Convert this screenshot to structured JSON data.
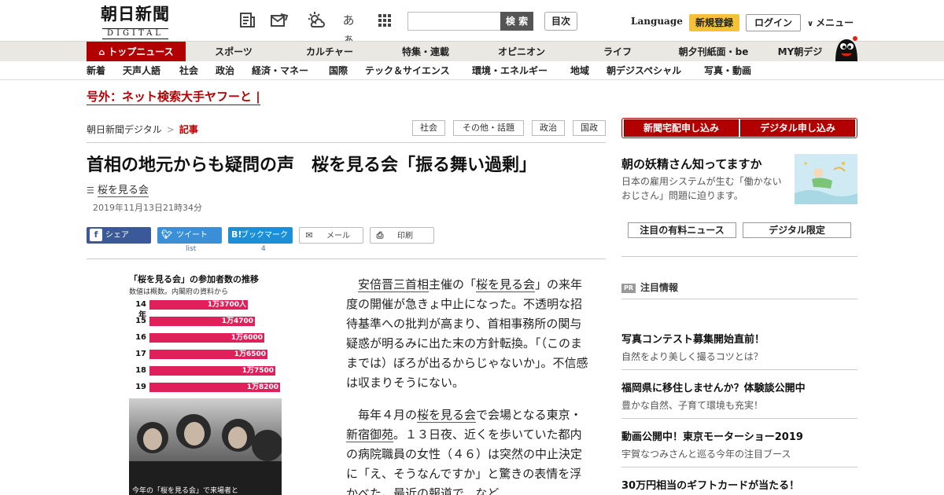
{
  "header": {
    "logo_main": "朝日新聞",
    "logo_sub": "DIGITAL",
    "search_button": "検 索",
    "search_placeholder": "",
    "index_button": "目次",
    "language": "Language",
    "register": "新規登録",
    "login": "ログイン",
    "menu": "メニュー",
    "icon_font_label": "あぁ"
  },
  "nav_primary": [
    {
      "label": "トップニュース",
      "active": true
    },
    {
      "label": "スポーツ"
    },
    {
      "label": "カルチャー"
    },
    {
      "label": "特集・連載"
    },
    {
      "label": "オピニオン"
    },
    {
      "label": "ライフ"
    },
    {
      "label": "朝夕刊紙面・be"
    },
    {
      "label": "MY朝デジ"
    }
  ],
  "nav_secondary": [
    "新着",
    "天声人語",
    "社会",
    "政治",
    "経済・マネー",
    "国際",
    "テック＆サイエンス",
    "環境・エネルギー",
    "地域",
    "朝デジスペシャル",
    "写真・動画"
  ],
  "breaking": "号外：ネット検索大手ヤフーと",
  "breadcrumb": {
    "home": "朝日新聞デジタル",
    "sep": ">",
    "current": "記事"
  },
  "tags": [
    "社会",
    "その他・話題",
    "政治",
    "国政"
  ],
  "article": {
    "headline": "首相の地元からも疑問の声　桜を見る会「振る舞い過剰」",
    "topic": "桜を見る会",
    "date": "2019年11月13日21時34分",
    "share": {
      "facebook": "シェア",
      "twitter": "ツイート",
      "twitter_count": "list",
      "hatena": "ブックマーク",
      "hatena_count": "4",
      "mail": "メール",
      "print": "印刷"
    },
    "p1": {
      "link1": "安倍晋三首相",
      "t1": "主催の「",
      "link2": "桜を見る会",
      "t2": "」の来年度の開催が急きょ中止になった。不透明な招待基準への批判が高まり、首相事務所の関与疑惑が明るみに出た末の方針転換。「（このままでは）ぼろが出るからじゃないか」。不信感は収まりそうにない。"
    },
    "p2": {
      "t1": "毎年４月の",
      "link1": "桜を見る会",
      "t2": "で会場となる東京・",
      "link2": "新宿御苑",
      "t3": "。１３日夜、近くを歩いていた都内の病院職員の女性（４６）は突然の中止決定に「え、そうなんですか」と驚きの表情を浮かべた。最近の報道で、など"
    }
  },
  "infographic": {
    "title": "「桜を見る会」の参加者数の推移",
    "subtitle": "数値は概数。内閣府の資料から",
    "caption": "今年の「桜を見る会」で来場者と",
    "rows": [
      {
        "year": "14年",
        "label": "1万3700人",
        "value": 13700
      },
      {
        "year": "15",
        "label": "1万4700",
        "value": 14700
      },
      {
        "year": "16",
        "label": "1万6000",
        "value": 16000
      },
      {
        "year": "17",
        "label": "1万6500",
        "value": 16500
      },
      {
        "year": "18",
        "label": "1万7500",
        "value": 17500
      },
      {
        "year": "19",
        "label": "1万8200",
        "value": 18200
      }
    ],
    "max_value": 18200
  },
  "sidebar": {
    "subscribe_paper": "新聞宅配申し込み",
    "subscribe_digital": "デジタル申し込み",
    "promo_title": "朝の妖精さん知ってますか",
    "promo_text": "日本の雇用システムが生む「働かないおじさん」問題に迫ります。",
    "button_news": "注目の有料ニュース",
    "button_digital": "デジタル限定",
    "pr_badge": "PR",
    "pr_heading": "注目情報",
    "pr_items": [
      {
        "title": "写真コンテスト募集開始直前！",
        "desc": "自然をより美しく撮るコツとは？"
      },
      {
        "title": "福岡県に移住しませんか？体験談公開中",
        "desc": "豊かな自然、子育て環境も充実！"
      },
      {
        "title": "動画公開中！東京モーターショー2019",
        "desc": "宇賀なつみさんと巡る今年の注目ブース"
      },
      {
        "title": "30万円相当のギフトカードが当たる！",
        "desc": ""
      }
    ]
  },
  "colors": {
    "brand_red": "#b20000",
    "accent_yellow": "#f3c23a",
    "chart_pink": "#e0205a"
  }
}
